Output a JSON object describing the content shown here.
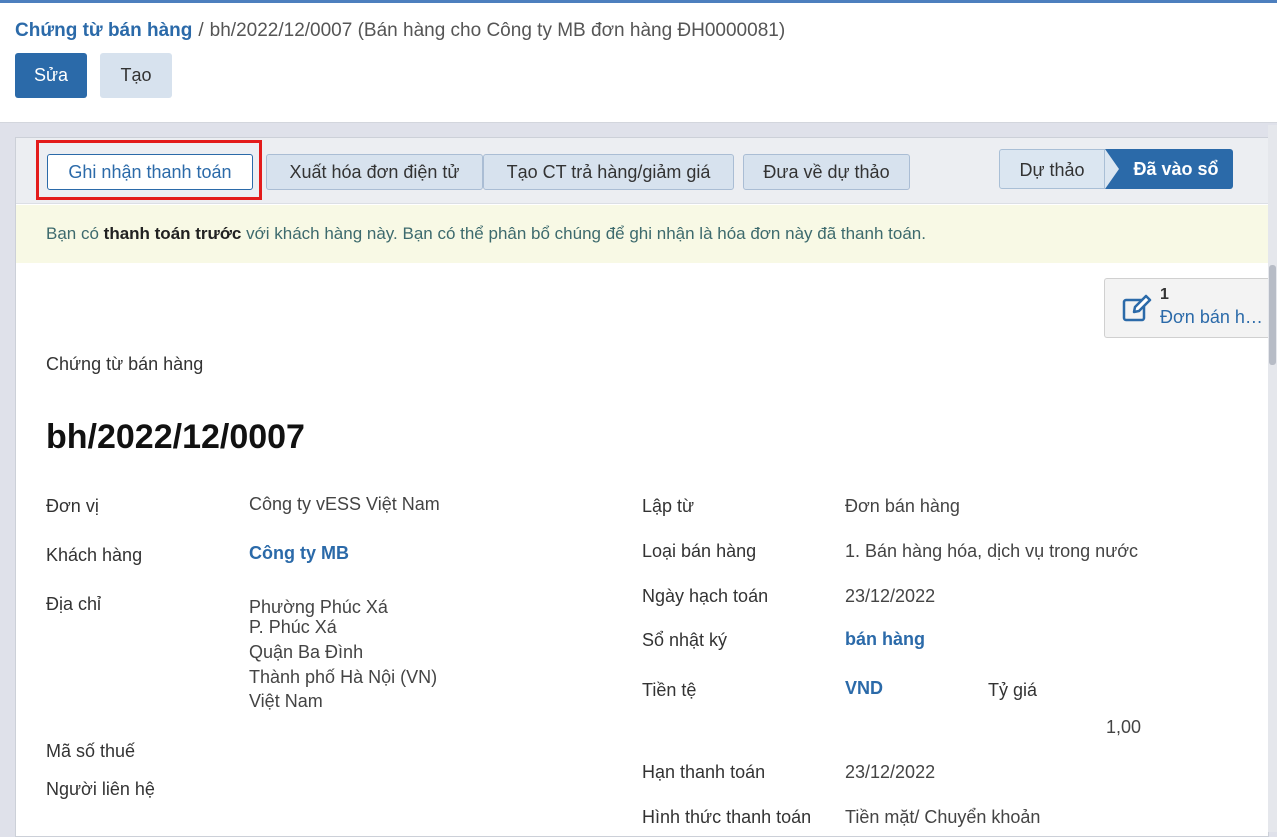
{
  "breadcrumb": {
    "parent": "Chứng từ bán hàng",
    "separator": "/",
    "current": "bh/2022/12/0007 (Bán hàng cho Công ty MB đơn hàng ĐH0000081)"
  },
  "toolbar": {
    "edit_label": "Sửa",
    "create_label": "Tạo"
  },
  "status_actions": [
    "Ghi nhận thanh toán",
    "Xuất hóa đơn điện tử",
    "Tạo CT trả hàng/giảm giá",
    "Đưa về dự thảo"
  ],
  "stages": {
    "draft": "Dự thảo",
    "posted": "Đã vào sổ",
    "active": "posted"
  },
  "alert": {
    "prefix": "Bạn có ",
    "bold": "thanh toán trước",
    "suffix": " với khách hàng này. Bạn có thể phân bổ chúng để ghi nhận là hóa đơn này đã thanh toán."
  },
  "smart_button": {
    "icon": "edit-icon",
    "count": "1",
    "label": "Đơn bán hàng"
  },
  "document": {
    "type_label": "Chứng từ bán hàng",
    "number": "bh/2022/12/0007"
  },
  "left_fields": {
    "unit_label": "Đơn vị",
    "unit_value": "Công ty vESS Việt Nam",
    "customer_label": "Khách hàng",
    "customer_value": "Công ty MB",
    "address_label": "Địa chỉ",
    "address_lines": [
      "Phường Phúc Xá",
      "P. Phúc Xá",
      "Quận Ba Đình",
      "Thành phố Hà Nội (VN)",
      "Việt Nam"
    ],
    "tax_label": "Mã số thuế",
    "contact_label": "Người liên hệ"
  },
  "right_fields": {
    "source_label": "Lập từ",
    "source_value": "Đơn bán hàng",
    "sale_type_label": "Loại bán hàng",
    "sale_type_value": "1. Bán hàng hóa, dịch vụ trong nước",
    "date_label": "Ngày hạch toán",
    "date_value": "23/12/2022",
    "journal_label": "Sổ nhật ký",
    "journal_value": "bán hàng",
    "currency_label": "Tiền tệ",
    "currency_value": "VND",
    "rate_label": "Tỷ giá",
    "rate_value": "1,00",
    "due_label": "Hạn thanh toán",
    "due_value": "23/12/2022",
    "payment_method_label": "Hình thức thanh toán",
    "payment_method_value": "Tiền mặt/ Chuyển khoản"
  },
  "colors": {
    "primary": "#2b6aa9",
    "highlight": "#e31b1b",
    "alert_bg": "#f8f9e5"
  }
}
